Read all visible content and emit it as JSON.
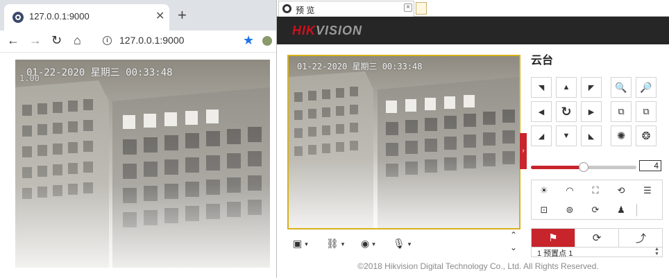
{
  "chrome": {
    "tab_title": "127.0.0.1:9000",
    "tab_close": "✕",
    "new_tab": "+",
    "address": "127.0.0.1:9000",
    "back_icon": "←",
    "forward_icon": "→",
    "reload_icon": "↻",
    "home_icon": "⌂",
    "info_icon": "i",
    "star_icon": "★",
    "osd_timestamp": "01-22-2020 星期三 00:33:48",
    "osd_zoom": "1.00"
  },
  "ie": {
    "tab_title": "预 览",
    "tab_close": "×"
  },
  "hikvision": {
    "logo_red": "HIK",
    "logo_grey": "VISION",
    "osd_timestamp": "01-22-2020 星期三 00:33:48",
    "copyright": "©2018 Hikvision Digital Technology Co., Ltd. All Rights Reserved.",
    "collapse_icon": "›",
    "ptz": {
      "title": "云台",
      "speed_value": "4",
      "speed_fraction": 0.5,
      "preset_row": "1    预置点 1",
      "preset_tab_icons": [
        "flag-icon",
        "refresh-icon",
        "trend-icon"
      ]
    },
    "video_toolbar": {
      "window_icon": "▣",
      "stream_icon": "⛓",
      "capture_icon": "◉",
      "audio_icon": "🎙",
      "caret": "▾",
      "scroll_up": "⌃",
      "scroll_down": "⌄"
    }
  },
  "colors": {
    "hik_red": "#c8242c",
    "header_dark": "#262626",
    "video_border": "#d8b11c",
    "chrome_accent": "#1a73e8"
  }
}
